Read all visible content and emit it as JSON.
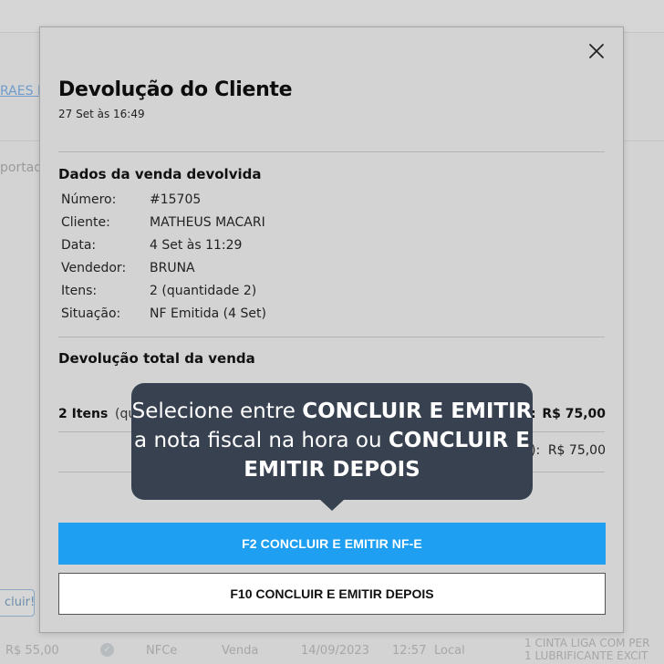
{
  "background": {
    "link_text": "RAES L",
    "side_text": "portad",
    "button_label": "cluir!",
    "row": {
      "value": "R$ 55,00",
      "doc_type": "NFCe",
      "type": "Venda",
      "date": "14/09/2023",
      "time": "12:57",
      "place": "Local",
      "item1": "1  CINTA LIGA COM PER",
      "item2": "1  LUBRIFICANTE EXCIT"
    }
  },
  "modal": {
    "title": "Devolução do Cliente",
    "subtitle": "27 Set às 16:49",
    "sale_section_title": "Dados da venda devolvida",
    "details": [
      {
        "label": "Número:",
        "value": "#15705"
      },
      {
        "label": "Cliente:",
        "value": "MATHEUS MACARI"
      },
      {
        "label": "Data:",
        "value": "4 Set às 11:29"
      },
      {
        "label": "Vendedor:",
        "value": "BRUNA"
      },
      {
        "label": "Itens:",
        "value": "2 (quantidade 2)"
      },
      {
        "label": "Situação:",
        "value": "NF Emitida (4 Set)"
      }
    ],
    "return_section_title": "Devolução total da venda",
    "items_label": "2 Itens",
    "items_detail": "(qu",
    "total_colon": ":",
    "total_value": "R$ 75,00",
    "sub_paren": "):",
    "sub_value": "R$ 75,00",
    "primary_button": "F2 CONCLUIR E EMITIR NF-E",
    "secondary_button": "F10 CONCLUIR E EMITIR DEPOIS"
  },
  "tooltip": {
    "part1": "Selecione entre ",
    "bold1": "CONCLUIR E EMITIR",
    "part2": " a nota fiscal na hora ou ",
    "bold2": "CONCLUIR E EMITIR DEPOIS"
  },
  "colors": {
    "primary": "#1e9ff2",
    "tooltip_bg": "#374150"
  }
}
